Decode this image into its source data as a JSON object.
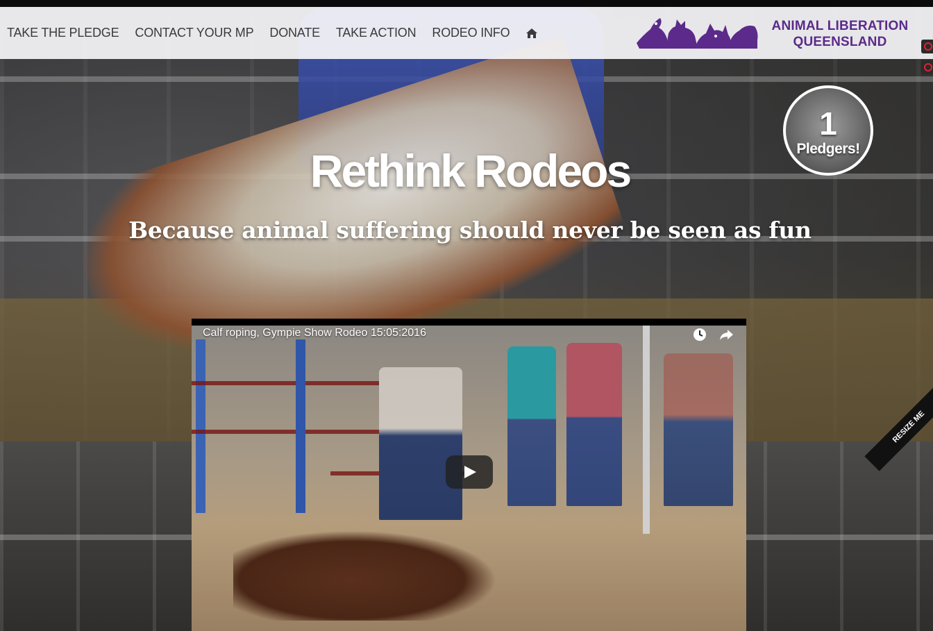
{
  "nav": {
    "items": [
      {
        "label": "TAKE THE PLEDGE"
      },
      {
        "label": "CONTACT YOUR MP"
      },
      {
        "label": "DONATE"
      },
      {
        "label": "TAKE ACTION"
      },
      {
        "label": "RODEO INFO"
      }
    ],
    "home_icon": "home-icon"
  },
  "brand": {
    "line1": "ANIMAL LIBERATION",
    "line2": "QUEENSLAND",
    "color": "#5b2a8a"
  },
  "hero": {
    "title": "Rethink Rodeos",
    "subtitle": "Because animal suffering should never be seen as fun"
  },
  "counter": {
    "count": "1",
    "label": "Pledgers!"
  },
  "video": {
    "title": "Calf roping, Gympie Show Rodeo 15:05:2016",
    "icons": [
      "clock-icon",
      "share-icon"
    ],
    "play_icon": "play-icon"
  },
  "ribbon": {
    "text": "RESIZE ME"
  }
}
